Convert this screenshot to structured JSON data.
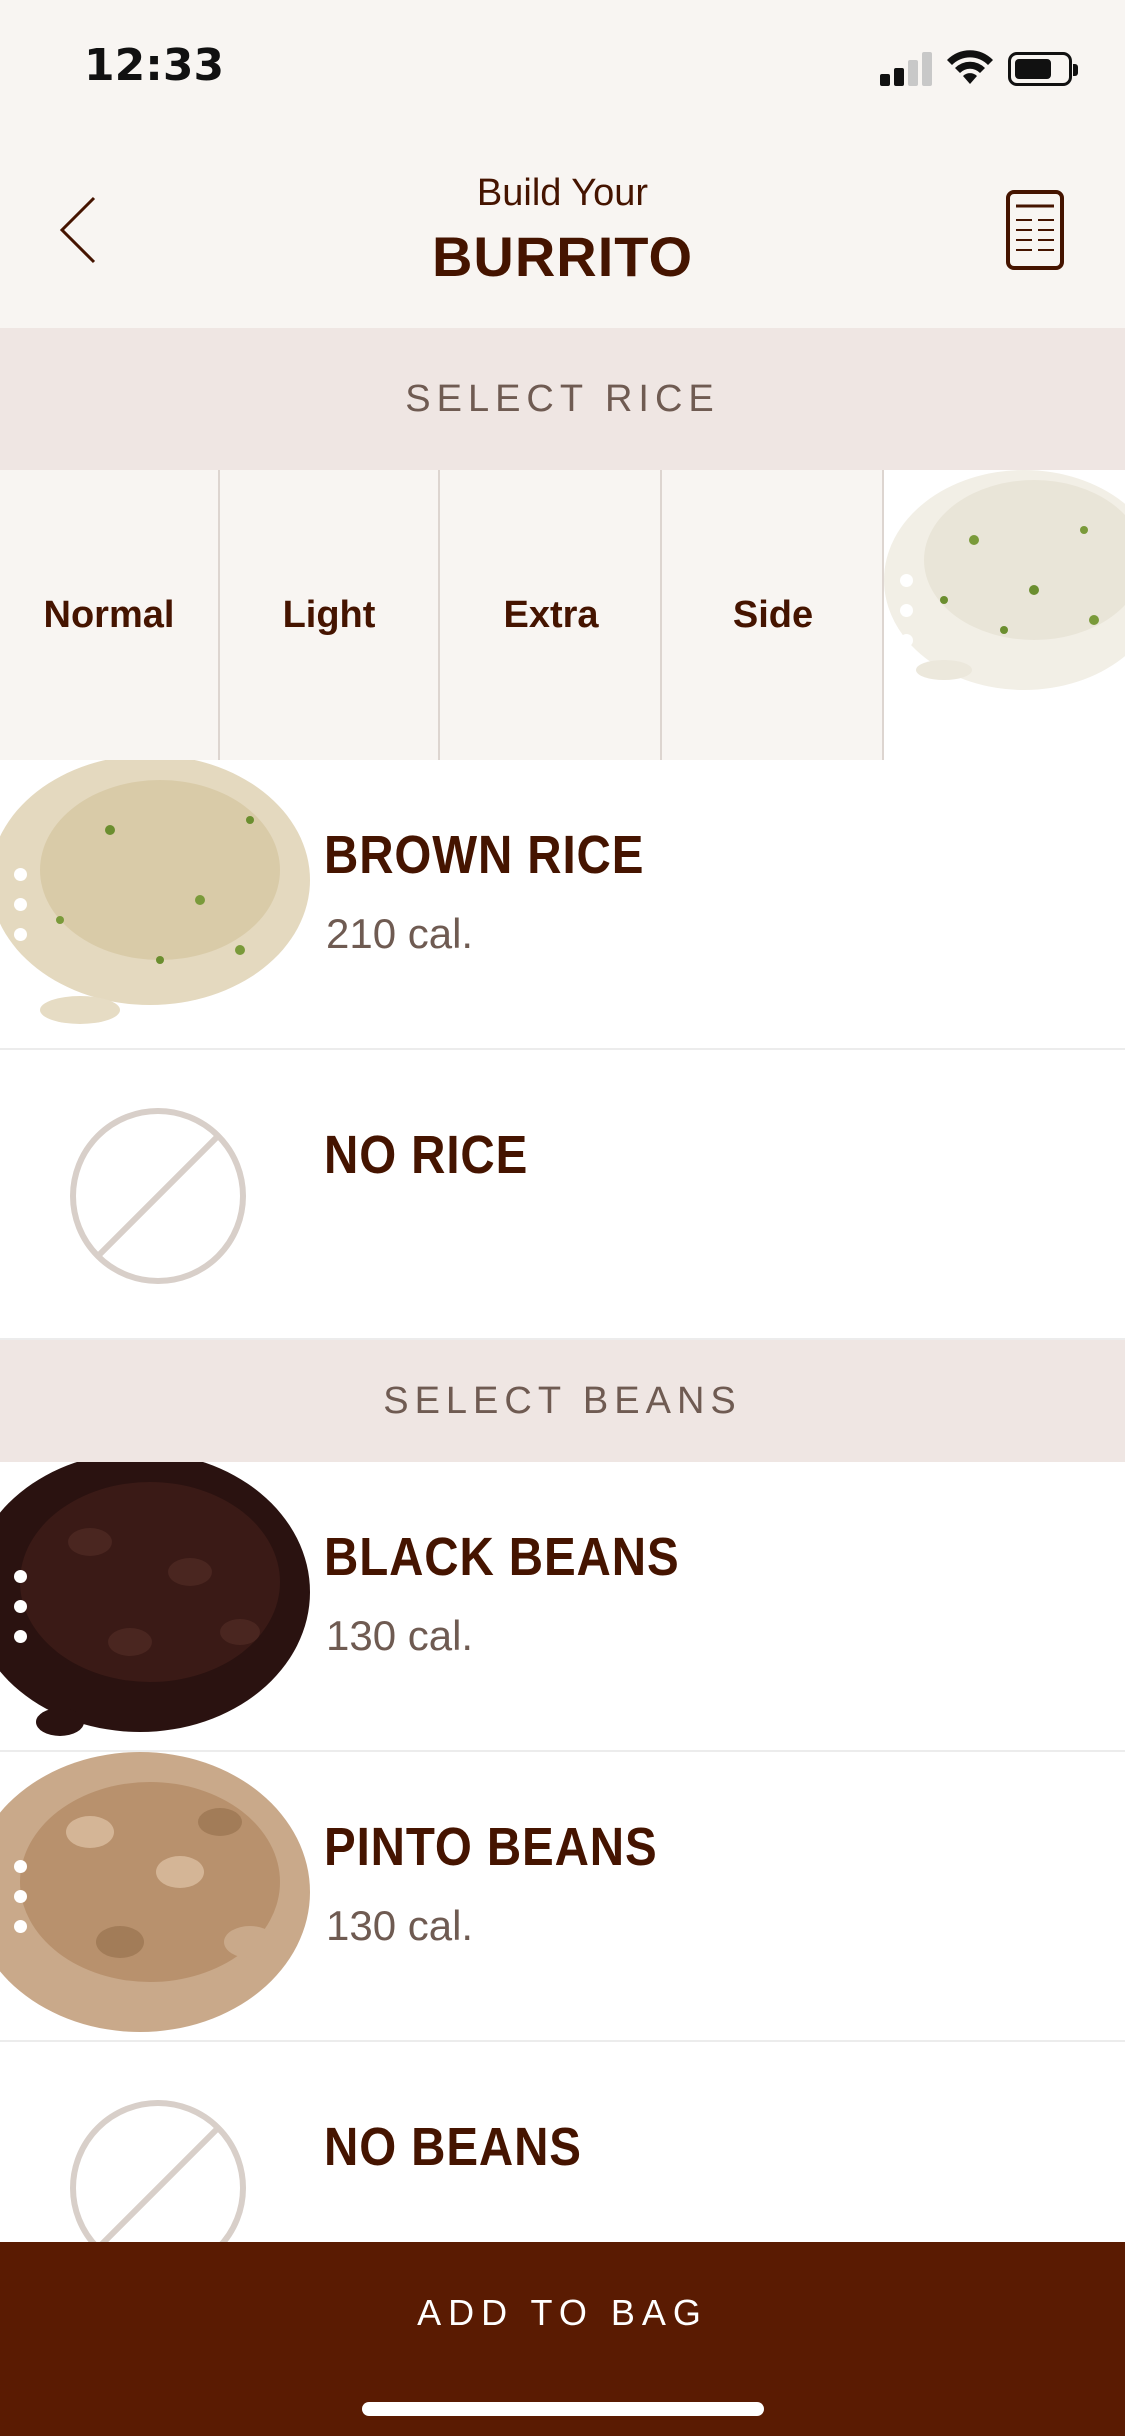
{
  "status_bar": {
    "time": "12:33",
    "signal_bars": 4,
    "signal_bars_active": 2
  },
  "header": {
    "title_top": "Build Your",
    "title_main": "BURRITO",
    "back_icon": "chevron-left-icon",
    "menu_icon": "nutrition-receipt-icon"
  },
  "rice_section": {
    "header": "SELECT RICE",
    "portions": [
      "Normal",
      "Light",
      "Extra",
      "Side"
    ],
    "items": [
      {
        "name": "BROWN RICE",
        "calories": "210 cal."
      },
      {
        "name": "NO RICE",
        "calories": ""
      }
    ]
  },
  "beans_section": {
    "header": "SELECT BEANS",
    "items": [
      {
        "name": "BLACK BEANS",
        "calories": "130 cal."
      },
      {
        "name": "PINTO BEANS",
        "calories": "130 cal."
      },
      {
        "name": "NO BEANS",
        "calories": ""
      }
    ]
  },
  "footer": {
    "add_to_bag": "ADD TO BAG"
  },
  "colors": {
    "brand_brown": "#451400",
    "footer_bg": "#5a1b02",
    "section_bg": "#efe6e3",
    "header_bg": "#f8f5f2"
  }
}
